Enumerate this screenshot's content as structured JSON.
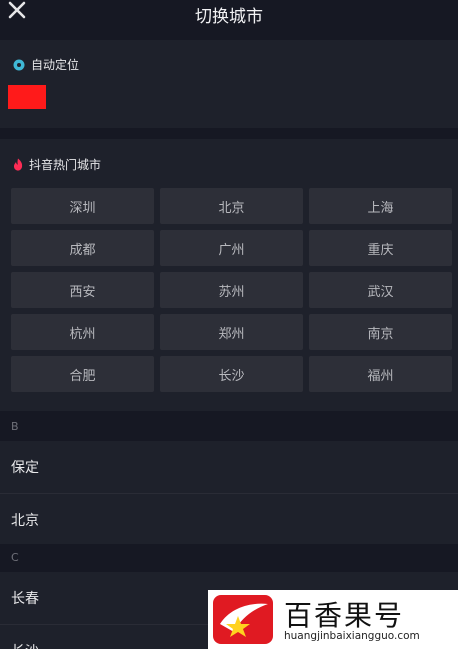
{
  "header": {
    "title": "切换城市",
    "close_icon": "close-icon"
  },
  "auto_location": {
    "label": "自动定位",
    "icon": "location-pin-icon",
    "accent": "#3fb8d6",
    "redacted_color": "#ff1a1a"
  },
  "hot_cities": {
    "label": "抖音热门城市",
    "icon": "flame-icon",
    "accent": "#fe2c55",
    "cities": [
      "深圳",
      "北京",
      "上海",
      "成都",
      "广州",
      "重庆",
      "西安",
      "苏州",
      "武汉",
      "杭州",
      "郑州",
      "南京",
      "合肥",
      "长沙",
      "福州"
    ]
  },
  "groups": [
    {
      "letter": "B",
      "cities": [
        "保定",
        "北京"
      ]
    },
    {
      "letter": "C",
      "cities": [
        "长春",
        "长沙"
      ]
    }
  ],
  "watermark": {
    "brand": "百香果号",
    "url": "huangjinbaixiangguo.com"
  }
}
